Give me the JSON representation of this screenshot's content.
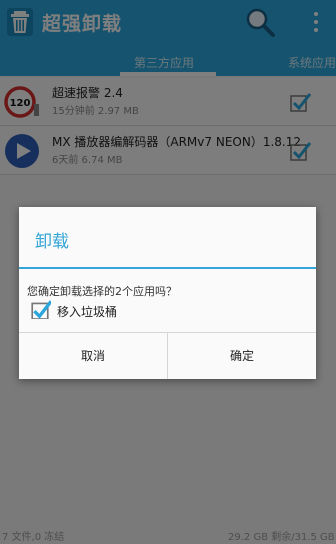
{
  "app": {
    "title": "超强卸载",
    "icon": "trash-can-icon",
    "search_icon": "search-icon",
    "overflow_icon": "more-vert-icon",
    "brand_color": "#2aa6dc"
  },
  "tabs": {
    "active": "第三方应用",
    "next": "系统应用"
  },
  "apps": [
    {
      "name": "超速报警 2.4",
      "meta": "15分钟前 2.97 MB",
      "icon": "speed-limit-120-icon",
      "checked": true
    },
    {
      "name": "MX 播放器编解码器（ARMv7 NEON）1.8.12",
      "meta": "6天前 6.74 MB",
      "icon": "play-icon",
      "checked": true
    }
  ],
  "footer": {
    "left": "7 文件,0 冻结",
    "right": "29.2 GB 剩余/31.5 GB"
  },
  "dialog": {
    "title": "卸载",
    "message": "您确定卸载选择的2个应用吗？",
    "checkbox_label": "移入垃圾桶",
    "checkbox_checked": true,
    "cancel": "取消",
    "confirm": "确定",
    "accent": "#33a5d6"
  }
}
